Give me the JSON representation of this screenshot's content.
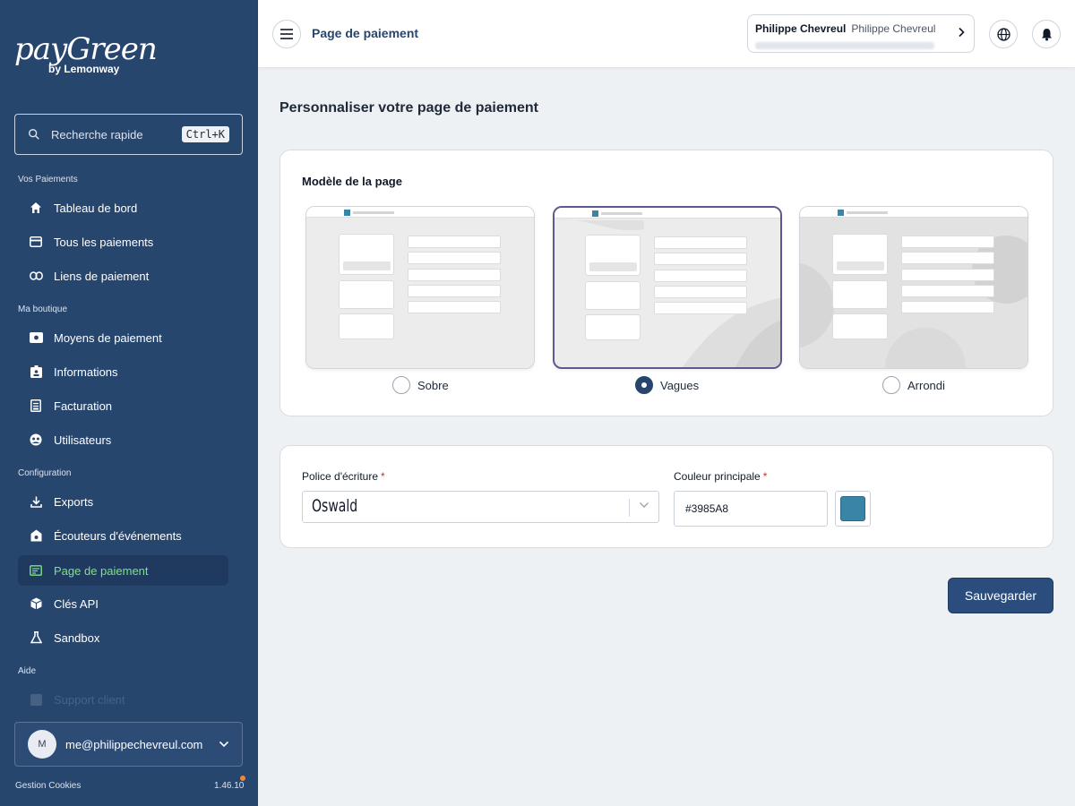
{
  "brand": {
    "logo": "payGreen",
    "tagline": "by Lemonway"
  },
  "search": {
    "placeholder": "Recherche rapide",
    "shortcut": "Ctrl+K"
  },
  "sidebar": {
    "sections": [
      {
        "label": "Vos Paiements"
      },
      {
        "label": "Ma boutique"
      },
      {
        "label": "Configuration"
      },
      {
        "label": "Aide"
      }
    ],
    "items": [
      {
        "label": "Tableau de bord",
        "icon": "home-icon"
      },
      {
        "label": "Tous les paiements",
        "icon": "card-icon"
      },
      {
        "label": "Liens de paiement",
        "icon": "link-icon"
      },
      {
        "label": "Moyens de paiement",
        "icon": "wallet-icon"
      },
      {
        "label": "Informations",
        "icon": "id-badge-icon"
      },
      {
        "label": "Facturation",
        "icon": "receipt-icon"
      },
      {
        "label": "Utilisateurs",
        "icon": "users-icon"
      },
      {
        "label": "Exports",
        "icon": "download-icon"
      },
      {
        "label": "Écouteurs d'événements",
        "icon": "webhook-icon"
      },
      {
        "label": "Page de paiement",
        "icon": "page-icon",
        "active": true
      },
      {
        "label": "Clés API",
        "icon": "cube-icon"
      },
      {
        "label": "Sandbox",
        "icon": "flask-icon"
      },
      {
        "label": "Support client",
        "icon": "support-icon"
      }
    ]
  },
  "user": {
    "initial": "M",
    "email": "me@philippechevreul.com"
  },
  "footer": {
    "cookies": "Gestion Cookies",
    "version": "1.46.10"
  },
  "header": {
    "title": "Page de paiement",
    "account_name": "Philippe Chevreul",
    "account_name_secondary": "Philippe Chevreul"
  },
  "main": {
    "title": "Personnaliser votre page de paiement",
    "template_card": {
      "title": "Modèle de la page",
      "options": [
        {
          "label": "Sobre",
          "selected": false
        },
        {
          "label": "Vagues",
          "selected": true
        },
        {
          "label": "Arrondi",
          "selected": false
        }
      ]
    },
    "style_card": {
      "font_label": "Police d'écriture",
      "font_value": "Oswald",
      "color_label": "Couleur principale",
      "color_value": "#3985A8",
      "required_mark": "*"
    },
    "save_label": "Sauvegarder"
  },
  "colors": {
    "sidebar_bg": "#27466e",
    "accent": "#27466e",
    "active_text": "#7fe08a",
    "primary_color": "#3985A8"
  }
}
